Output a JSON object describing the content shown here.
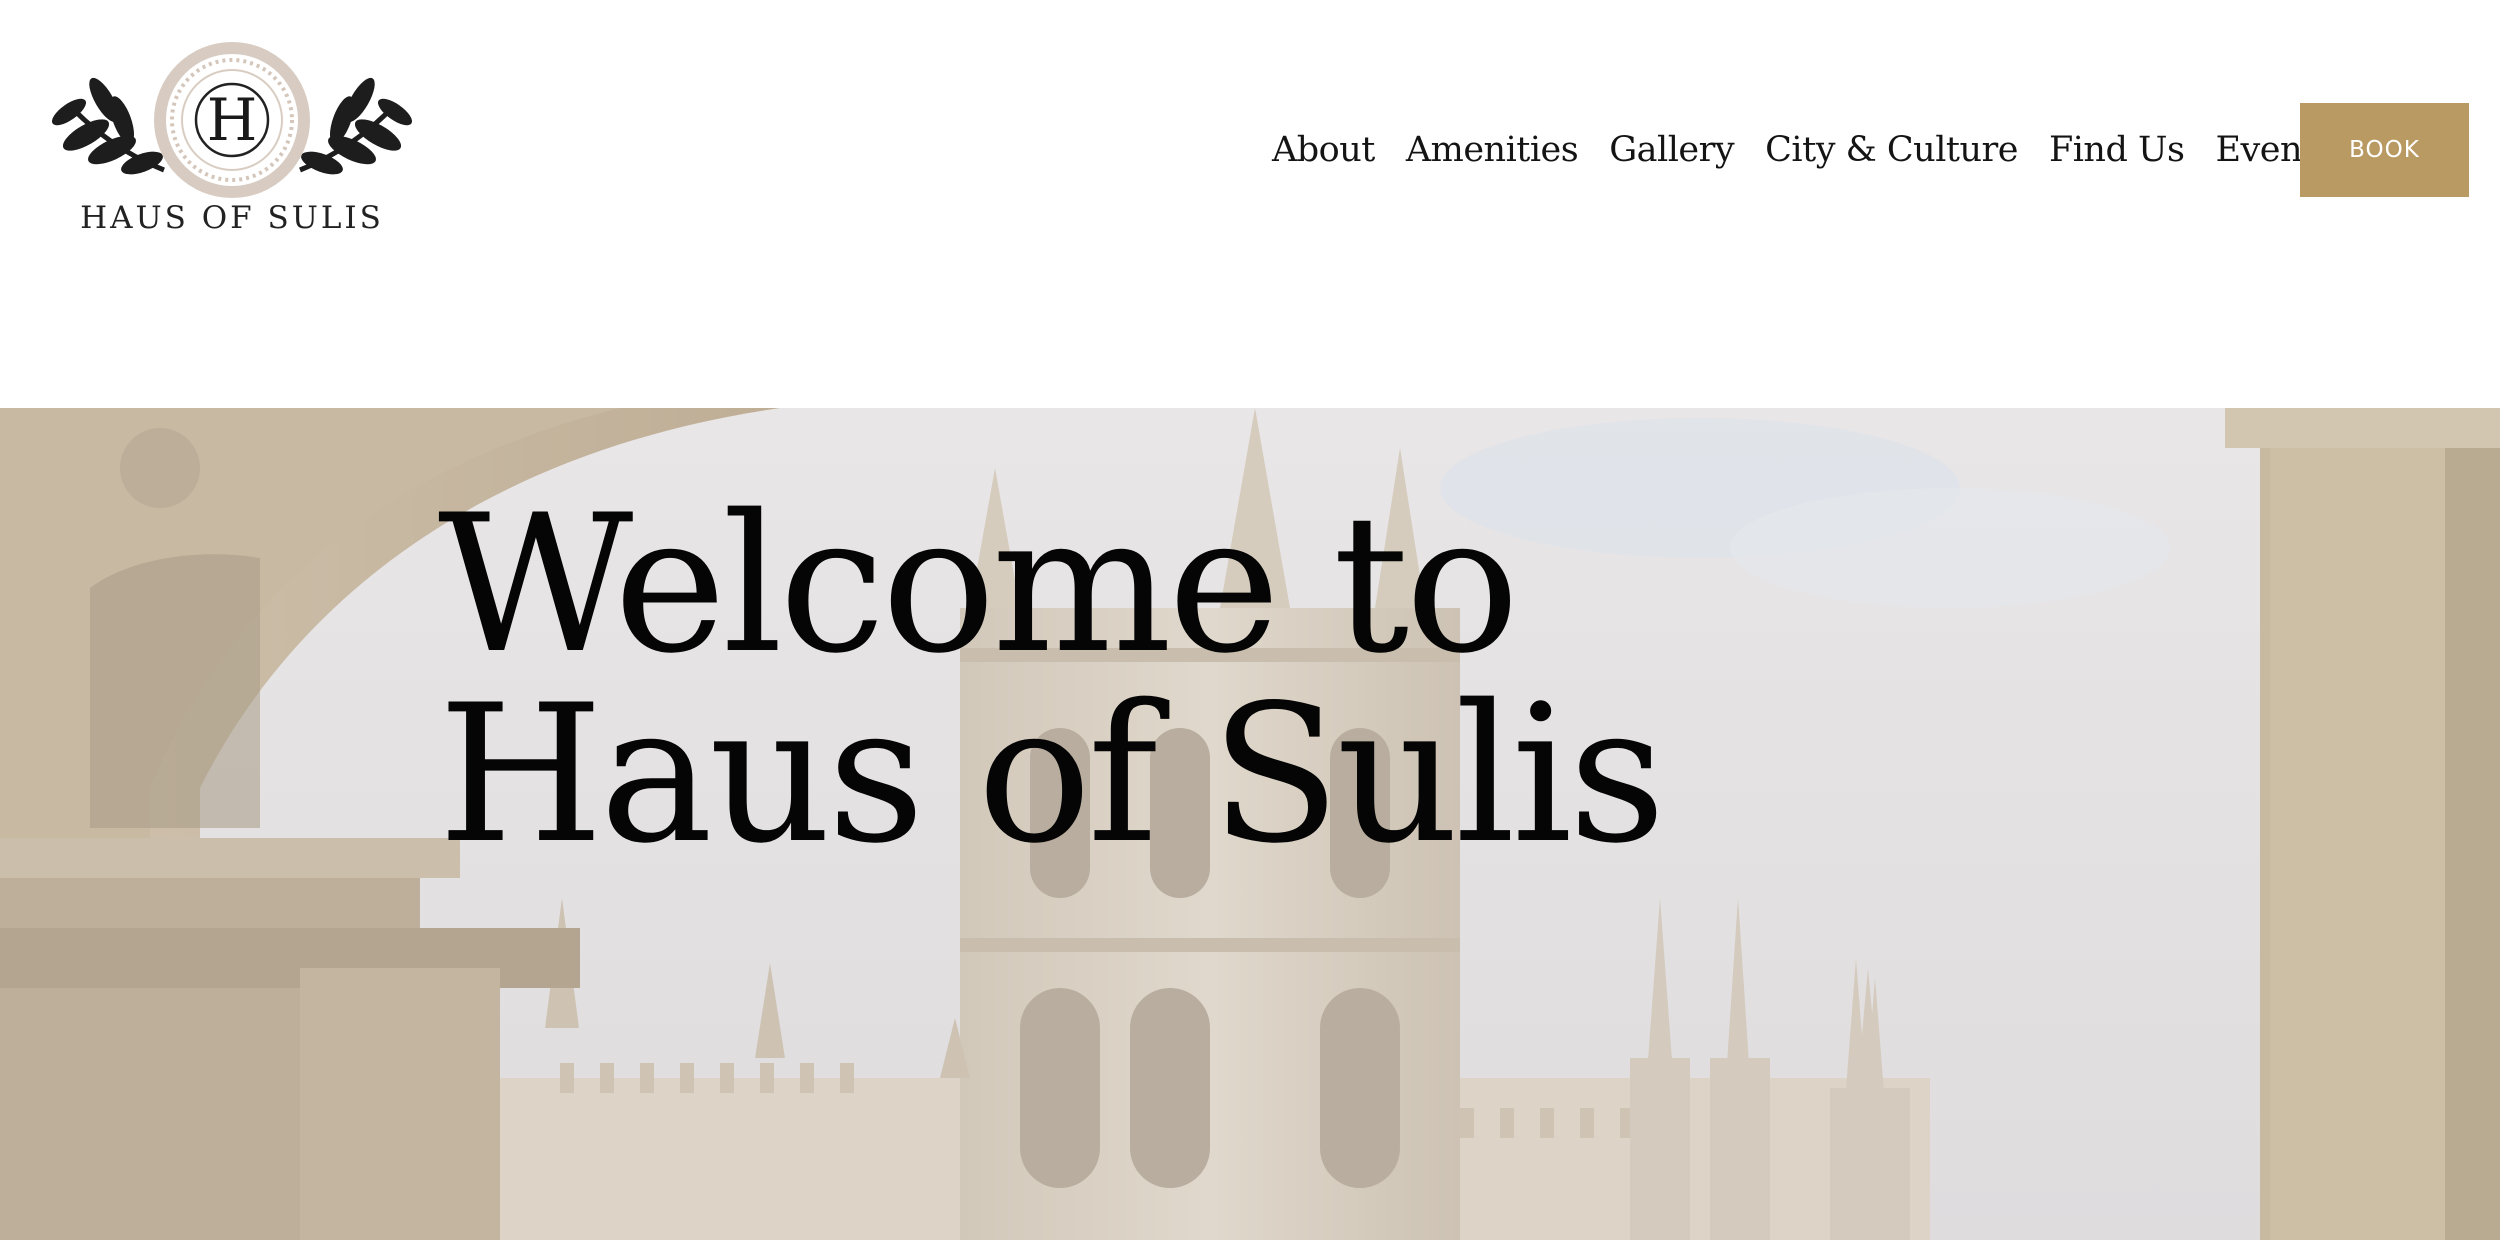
{
  "brand": {
    "monogram": "H",
    "name": "HAUS OF SULIS",
    "logo_icon": "laurel-wreath-monogram"
  },
  "nav": {
    "items": [
      {
        "label": "About"
      },
      {
        "label": "Amenities"
      },
      {
        "label": "Gallery"
      },
      {
        "label": "City & Culture"
      },
      {
        "label": "Find Us"
      },
      {
        "label": "Events"
      }
    ],
    "book_label": "BOOK"
  },
  "hero": {
    "title_line1": "Welcome to",
    "title_line2": "Haus of Sulis",
    "image": "bath-abbey-through-colonnade-arch"
  },
  "colors": {
    "accent": "#b99a63",
    "text": "#141414",
    "sky": "#e6e3e2",
    "stone": "#cdbfa9"
  }
}
